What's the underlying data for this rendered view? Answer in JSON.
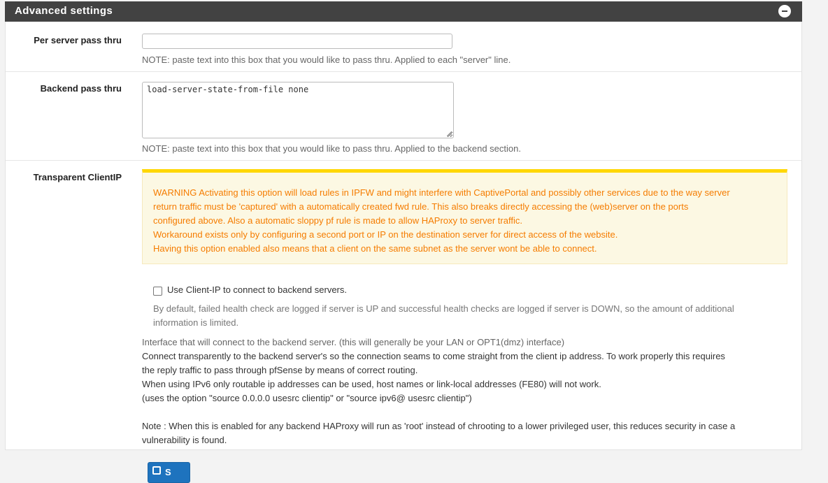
{
  "panel": {
    "title": "Advanced settings",
    "collapse_icon": "minus-circle-icon"
  },
  "per_server": {
    "label": "Per server pass thru",
    "value": "",
    "help": "NOTE: paste text into this box that you would like to pass thru. Applied to each \"server\" line."
  },
  "backend_pass": {
    "label": "Backend pass thru",
    "value": "load-server-state-from-file none",
    "help": "NOTE: paste text into this box that you would like to pass thru. Applied to the backend section."
  },
  "transparent": {
    "label": "Transparent ClientIP",
    "warning_lines": [
      "WARNING Activating this option will load rules in IPFW and might interfere with CaptivePortal and possibly other services due to the way server",
      "return traffic must be 'captured' with a automatically created fwd rule. This also breaks directly accessing the (web)server on the ports",
      "configured above. Also a automatic sloppy pf rule is made to allow HAProxy to server traffic.",
      "Workaround exists only by configuring a second port or IP on the destination server for direct access of the website.",
      "Having this option enabled also means that a client on the same subnet as the server wont be able to connect."
    ],
    "checkbox_label": "Use Client-IP to connect to backend servers.",
    "checkbox_checked": false,
    "checkbox_help_lines": [
      "By default, failed health check are logged if server is UP and successful health checks are logged if server is DOWN, so the amount of additional",
      "information is limited."
    ],
    "info_lines": [
      "Interface that will connect to the backend server. (this will generally be your LAN or OPT1(dmz) interface)",
      "Connect transparently to the backend server's so the connection seams to come straight from the client ip address. To work properly this requires",
      "the reply traffic to pass through pfSense by means of correct routing.",
      "When using IPv6 only routable ip addresses can be used, host names or link-local addresses (FE80) will not work.",
      "(uses the option \"source 0.0.0.0 usesrc clientip\" or \"source ipv6@ usesrc clientip\")",
      "",
      "Note : When this is enabled for any backend HAProxy will run as 'root' instead of chrooting to a lower privileged user, this reduces security in case a",
      "vulnerability is found."
    ]
  },
  "save_button": {
    "label": "S",
    "icon": "save-icon"
  },
  "colors": {
    "header_bg": "#424242",
    "warning_text": "#f57c00",
    "warning_border": "#ffd700",
    "warning_bg": "#fcf8e3",
    "primary": "#1e73be"
  }
}
